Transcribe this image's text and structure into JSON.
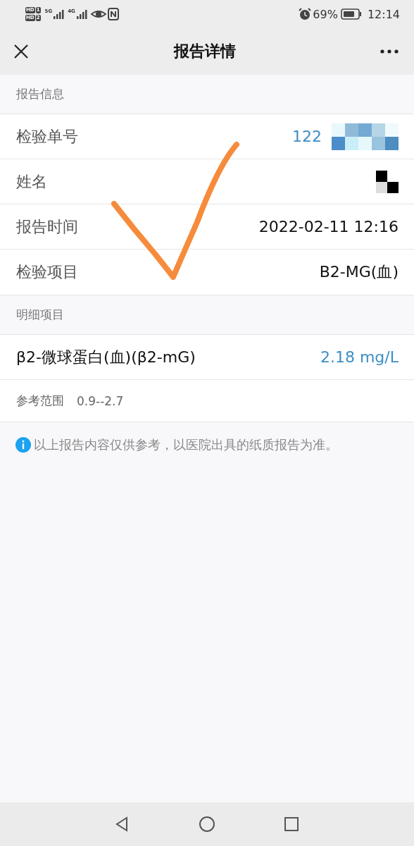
{
  "status_bar": {
    "sim_badges": [
      {
        "label": "HD",
        "slot": "1"
      },
      {
        "label": "HD",
        "slot": "2"
      }
    ],
    "networks": [
      "5G",
      "4G"
    ],
    "battery": "69%",
    "time": "12:14"
  },
  "header": {
    "title": "报告详情"
  },
  "report_info": {
    "heading": "报告信息",
    "rows": [
      {
        "label": "检验单号",
        "value": "122",
        "redacted": true,
        "kind": "link"
      },
      {
        "label": "姓名",
        "redacted": true,
        "kind": "name"
      },
      {
        "label": "报告时间",
        "value": "2022-02-11 12:16",
        "kind": "text"
      },
      {
        "label": "检验项目",
        "value": "B2-MG(血)",
        "kind": "text"
      }
    ]
  },
  "details": {
    "heading": "明细项目",
    "items": [
      {
        "name": "β2-微球蛋白(血)(β2-mG)",
        "result": "2.18 mg/L",
        "range_label": "参考范围",
        "range": "0.9--2.7"
      }
    ]
  },
  "notice": "以上报告内容仅供参考，以医院出具的纸质报告为准。"
}
